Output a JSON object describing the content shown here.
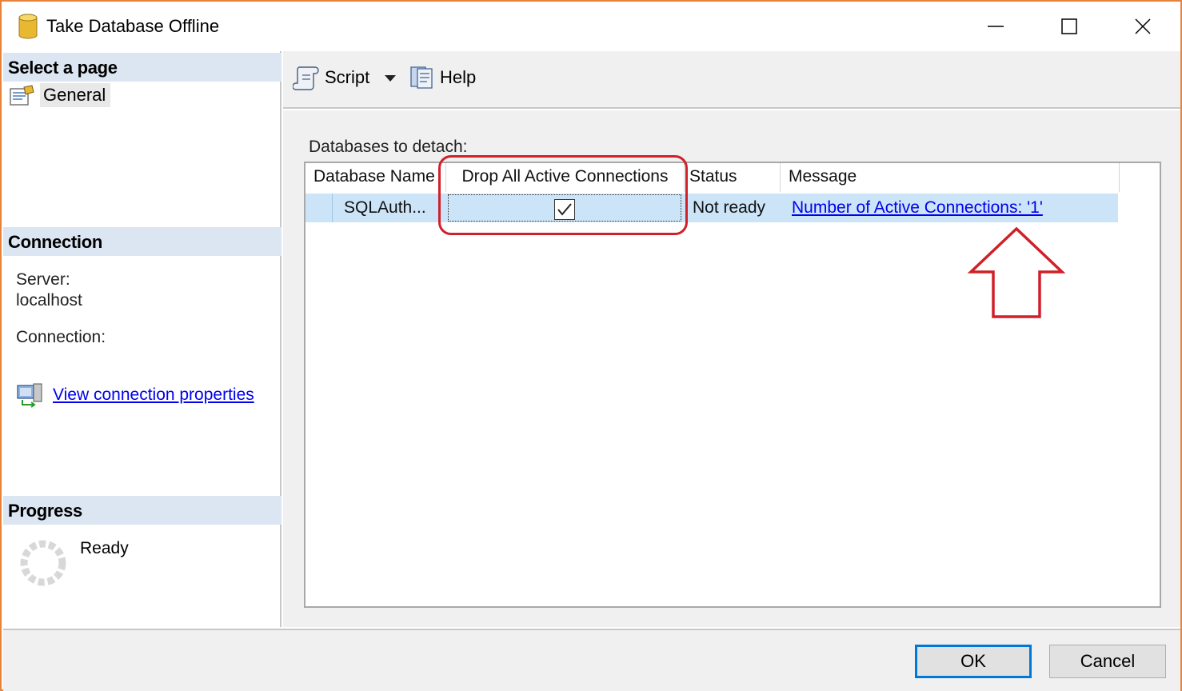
{
  "window": {
    "title": "Take Database Offline",
    "accent": "#e8823a"
  },
  "left_panel": {
    "select_page_header": "Select a page",
    "pages": [
      {
        "label": "General",
        "icon": "general-page-icon"
      }
    ],
    "connection_header": "Connection",
    "server_label": "Server:",
    "server_value": "localhost",
    "connection_label": "Connection:",
    "view_connection_link": "View connection properties",
    "progress_header": "Progress",
    "progress_status": "Ready"
  },
  "toolbar": {
    "script_label": "Script",
    "help_label": "Help"
  },
  "grid": {
    "caption": "Databases to detach:",
    "columns": [
      "Database Name",
      "Drop All Active Connections",
      "Status",
      "Message"
    ],
    "rows": [
      {
        "database_name": "SQLAuth...",
        "drop_all_active_connections": true,
        "status": "Not ready",
        "message": "Number of Active Connections: '1'"
      }
    ]
  },
  "buttons": {
    "ok_label": "OK",
    "cancel_label": "Cancel"
  },
  "colors": {
    "section_header": "#dbe6f2",
    "selected_row": "#cce4f7",
    "annotation": "#d0202a",
    "link": "#0000ee"
  }
}
